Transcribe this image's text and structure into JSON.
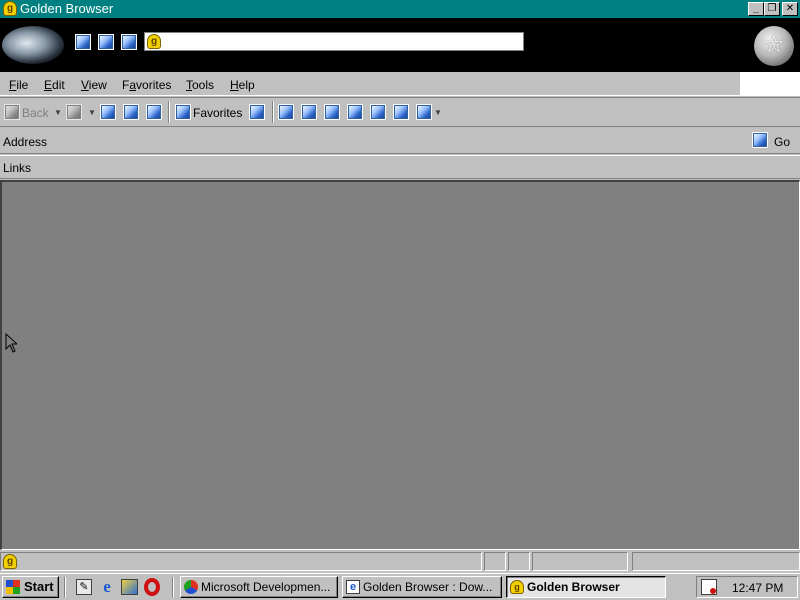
{
  "window": {
    "title": "Golden Browser",
    "app_icon": "golden-browser-icon",
    "controls": [
      "minimize-icon",
      "restore-icon",
      "close-icon"
    ]
  },
  "brand_band": {
    "search_value": "",
    "star_icon": "star-icon"
  },
  "menu": {
    "items": [
      {
        "label": "File",
        "accel": "F"
      },
      {
        "label": "Edit",
        "accel": "E"
      },
      {
        "label": "View",
        "accel": "V"
      },
      {
        "label": "Favorites",
        "accel": "a"
      },
      {
        "label": "Tools",
        "accel": "T"
      },
      {
        "label": "Help",
        "accel": "H"
      }
    ]
  },
  "toolbar": {
    "back_label": "Back",
    "favorites_label": "Favorites"
  },
  "address_bar": {
    "label": "Address",
    "value": "",
    "go_label": "Go"
  },
  "links_bar": {
    "label": "Links"
  },
  "status_bar": {
    "text": ""
  },
  "taskbar": {
    "start_label": "Start",
    "quick_launch": [
      "show-desktop-icon",
      "internet-explorer-icon",
      "network-icon",
      "opera-icon"
    ],
    "tasks": [
      {
        "label": "Microsoft Developmen...",
        "icon": "devstudio-icon",
        "active": false
      },
      {
        "label": "Golden Browser : Dow...",
        "icon": "ie-page-icon",
        "active": false
      },
      {
        "label": "Golden Browser",
        "icon": "golden-browser-icon",
        "active": true
      }
    ],
    "clock": "12:47 PM",
    "tray_icon": "volume-icon"
  },
  "colors": {
    "titlebar": "#008080",
    "desktop_face": "#c0c0c0",
    "content_bg": "#808080",
    "brand_band": "#000000"
  }
}
